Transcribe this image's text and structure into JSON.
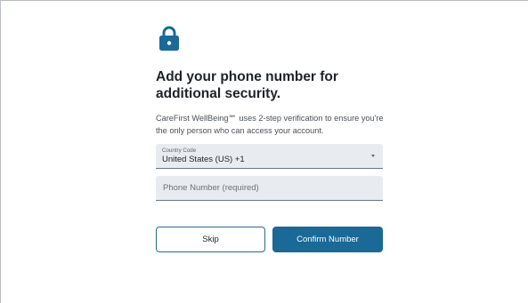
{
  "colors": {
    "accent": "#1a6996",
    "field_bg": "#e8ecf0",
    "text": "#1f2328"
  },
  "icon": "lock-icon",
  "heading": "Add your phone number for additional security.",
  "description": "CareFirst WellBeing℠ uses 2-step verification to ensure you're the only person who can access your account.",
  "country": {
    "caption": "Country Code",
    "value": "United States (US) +1"
  },
  "phone": {
    "placeholder": "Phone Number (required)",
    "value": ""
  },
  "buttons": {
    "skip_label": "Skip",
    "confirm_label": "Confirm Number"
  }
}
